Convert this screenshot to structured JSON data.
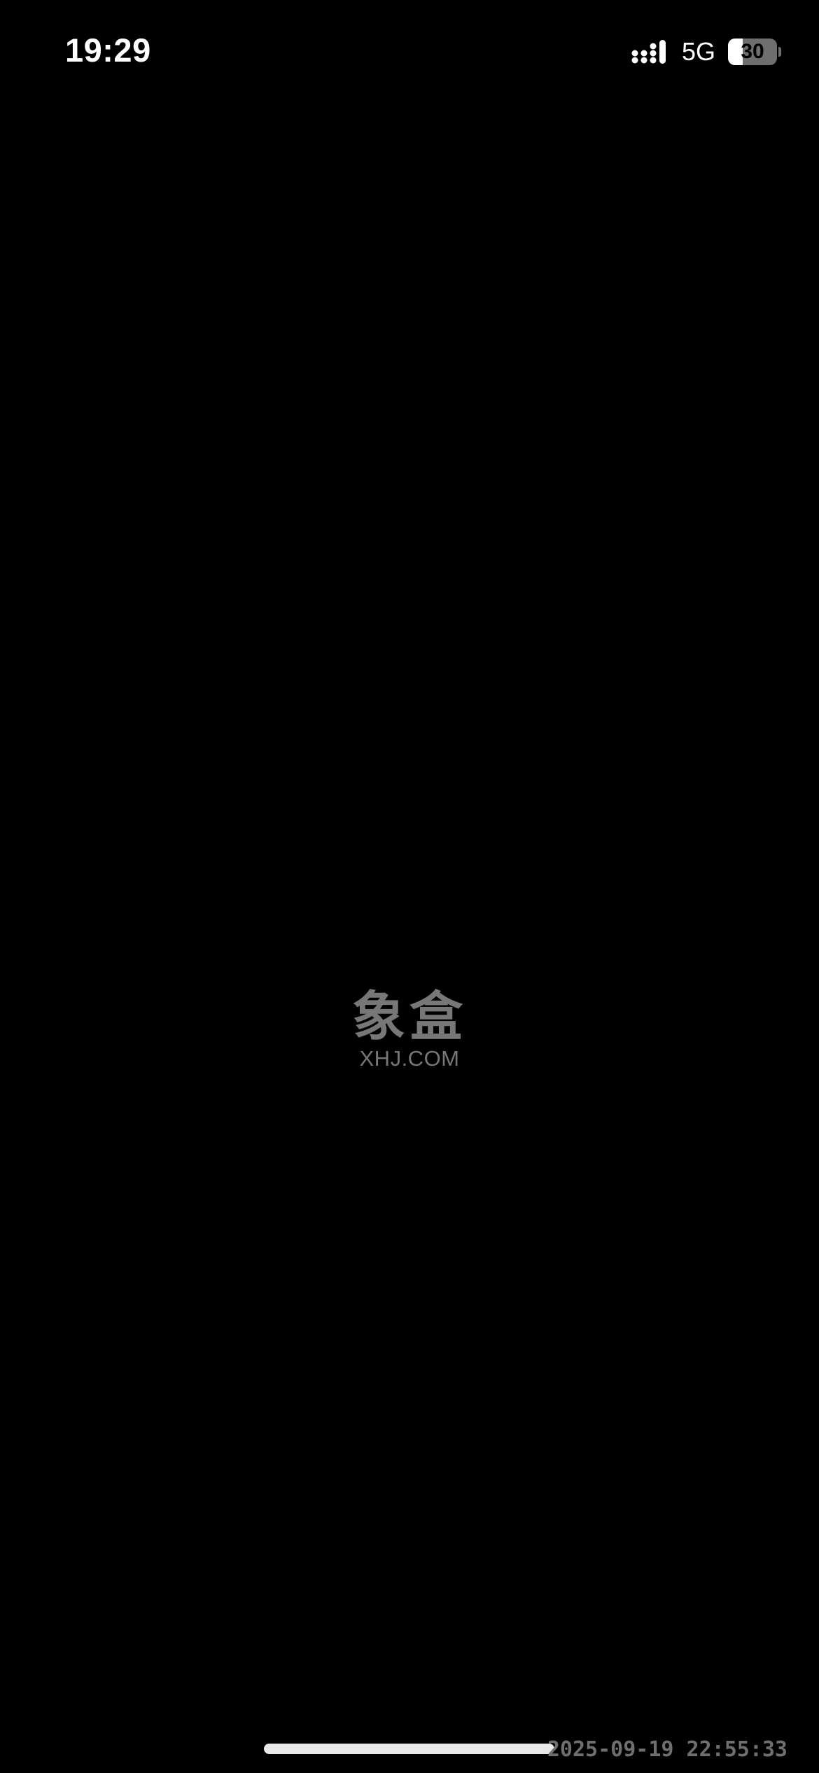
{
  "status_bar": {
    "time": "19:29",
    "network": "5G",
    "signal_icon": "cellular-signal-icon",
    "battery_icon": "battery-icon",
    "battery_level": "30",
    "battery_fraction": 0.3
  },
  "splash": {
    "logo_mark": "象盒",
    "logo_domain": "XHJ.COM",
    "logo_color": "#777777",
    "background_color": "#000000"
  },
  "overlay": {
    "timestamp": "2025-09-19 22:55:33"
  },
  "home_indicator": {
    "icon": "home-indicator-bar"
  }
}
